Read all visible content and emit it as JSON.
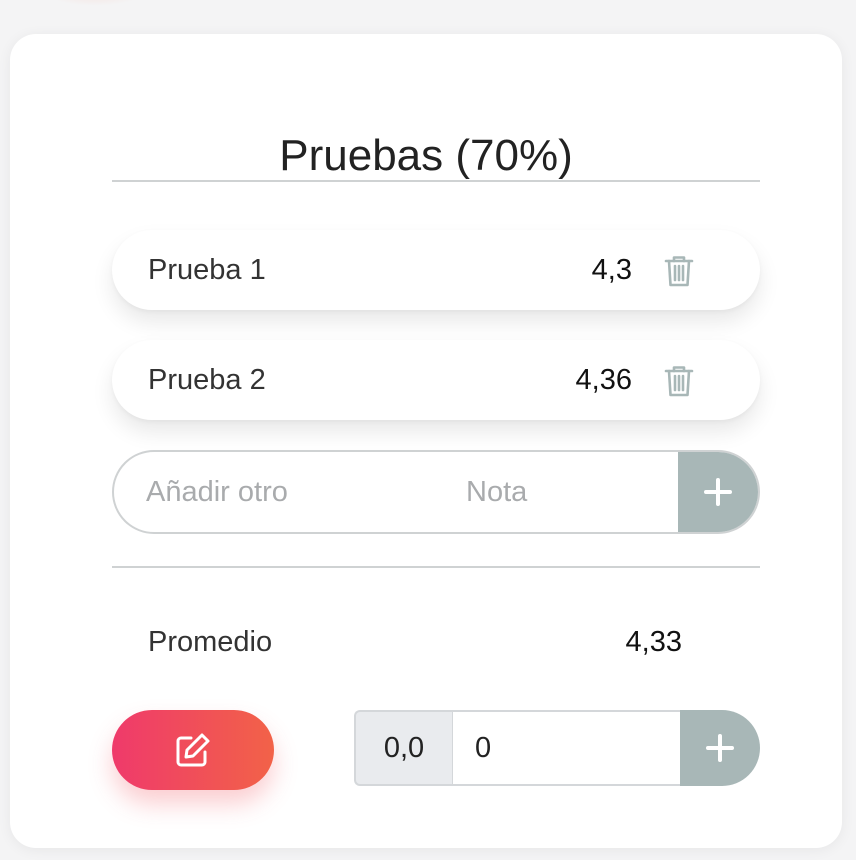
{
  "card": {
    "title": "Pruebas (70%)"
  },
  "grades": [
    {
      "name": "Prueba 1",
      "grade": "4,3"
    },
    {
      "name": "Prueba 2",
      "grade": "4,36"
    }
  ],
  "add_form": {
    "name_placeholder": "Añadir otro",
    "grade_placeholder": "Nota"
  },
  "average": {
    "label": "Promedio",
    "value": "4,33"
  },
  "weight": {
    "prefix": "0,0",
    "value": "0"
  },
  "colors": {
    "accent_gradient_start": "#ef3a6b",
    "accent_gradient_end": "#f26248",
    "add_button": "#a8b7b7",
    "trash_icon": "#a8b7b7"
  },
  "icons": {
    "delete": "trash-icon",
    "add": "plus-icon",
    "edit": "edit-icon"
  }
}
